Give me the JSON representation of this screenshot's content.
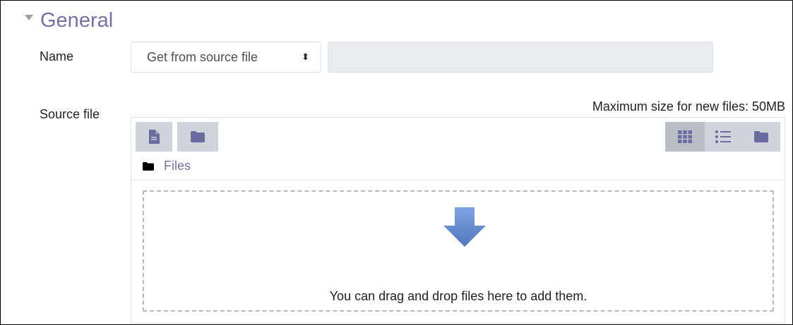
{
  "section": {
    "title": "General"
  },
  "name_field": {
    "label": "Name",
    "select_value": "Get from source file",
    "select_arrows": "⬍",
    "input_value": ""
  },
  "source_file": {
    "label": "Source file",
    "max_size_text": "Maximum size for new files: 50MB"
  },
  "filepicker": {
    "path_root": "Files",
    "drop_text": "You can drag and drop files here to add them.",
    "toolbar_left": [
      "add-file-icon",
      "create-folder-icon"
    ],
    "view_modes": [
      "grid-view-icon",
      "list-view-icon",
      "tree-view-icon"
    ],
    "active_view": "grid-view-icon"
  },
  "colors": {
    "accent": "#7470a3",
    "toolbar_button": "#ced4da",
    "toolbar_button_active": "#b9bec4",
    "input_disabled": "#e9ecef",
    "drop_arrow": "#5f86c9"
  }
}
